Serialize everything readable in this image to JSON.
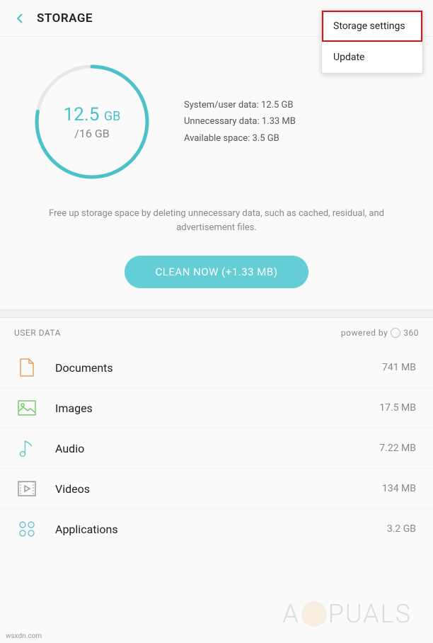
{
  "header": {
    "title": "STORAGE"
  },
  "menu": {
    "items": [
      {
        "label": "Storage settings",
        "highlighted": true
      },
      {
        "label": "Update",
        "highlighted": false
      }
    ]
  },
  "storage": {
    "used_value": "12.5",
    "used_unit": "GB",
    "total_label": "/16 GB",
    "percent_used": 78,
    "stats": {
      "system_label": "System/user data: 12.5 GB",
      "unnecessary_label": "Unnecessary data: 1.33 MB",
      "available_label": "Available space: 3.5 GB"
    }
  },
  "hint": "Free up storage space by deleting unnecessary data, such as cached, residual, and advertisement files.",
  "clean_button": "CLEAN NOW (+1.33 MB)",
  "user_data": {
    "header": "USER DATA",
    "powered_by": "powered by",
    "powered_brand": "360",
    "items": [
      {
        "label": "Documents",
        "size": "741 MB",
        "icon": "document-icon",
        "color": "#e8a05a"
      },
      {
        "label": "Images",
        "size": "17.5 MB",
        "icon": "image-icon",
        "color": "#7bc96f"
      },
      {
        "label": "Audio",
        "size": "7.22 MB",
        "icon": "audio-icon",
        "color": "#6dc7d0"
      },
      {
        "label": "Videos",
        "size": "134 MB",
        "icon": "video-icon",
        "color": "#999"
      },
      {
        "label": "Applications",
        "size": "3.2 GB",
        "icon": "apps-icon",
        "color": "#6dc7d0"
      }
    ]
  },
  "watermark": {
    "prefix": "A",
    "suffix": "PUALS"
  },
  "source": "wsxdn.com"
}
